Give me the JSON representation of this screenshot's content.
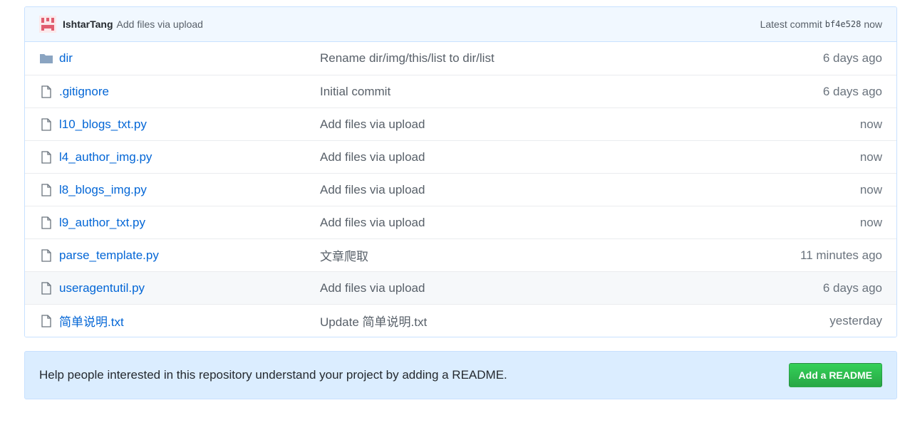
{
  "commit": {
    "author": "IshtarTang",
    "message": "Add files via upload",
    "latest_label": "Latest commit",
    "sha": "bf4e528",
    "age": "now"
  },
  "files": [
    {
      "type": "dir",
      "name": "dir",
      "message": "Rename dir/img/this/list to dir/list",
      "age": "6 days ago"
    },
    {
      "type": "file",
      "name": ".gitignore",
      "message": "Initial commit",
      "age": "6 days ago"
    },
    {
      "type": "file",
      "name": "l10_blogs_txt.py",
      "message": "Add files via upload",
      "age": "now"
    },
    {
      "type": "file",
      "name": "l4_author_img.py",
      "message": "Add files via upload",
      "age": "now"
    },
    {
      "type": "file",
      "name": "l8_blogs_img.py",
      "message": "Add files via upload",
      "age": "now"
    },
    {
      "type": "file",
      "name": "l9_author_txt.py",
      "message": "Add files via upload",
      "age": "now"
    },
    {
      "type": "file",
      "name": "parse_template.py",
      "message": "文章爬取",
      "age": "11 minutes ago"
    },
    {
      "type": "file",
      "name": "useragentutil.py",
      "message": "Add files via upload",
      "age": "6 days ago"
    },
    {
      "type": "file",
      "name": "简单说明.txt",
      "message": "Update 简单说明.txt",
      "age": "yesterday"
    }
  ],
  "readme": {
    "text": "Help people interested in this repository understand your project by adding a README.",
    "button": "Add a README"
  },
  "colors": {
    "link": "#0366d6",
    "header_bg": "#f1f8ff",
    "readme_bg": "#dbedff",
    "button_green": "#28a745",
    "hover_row": "#f6f8fa"
  },
  "icons": {
    "avatar": "identicon-avatar",
    "dir": "folder-icon",
    "file": "file-icon"
  }
}
